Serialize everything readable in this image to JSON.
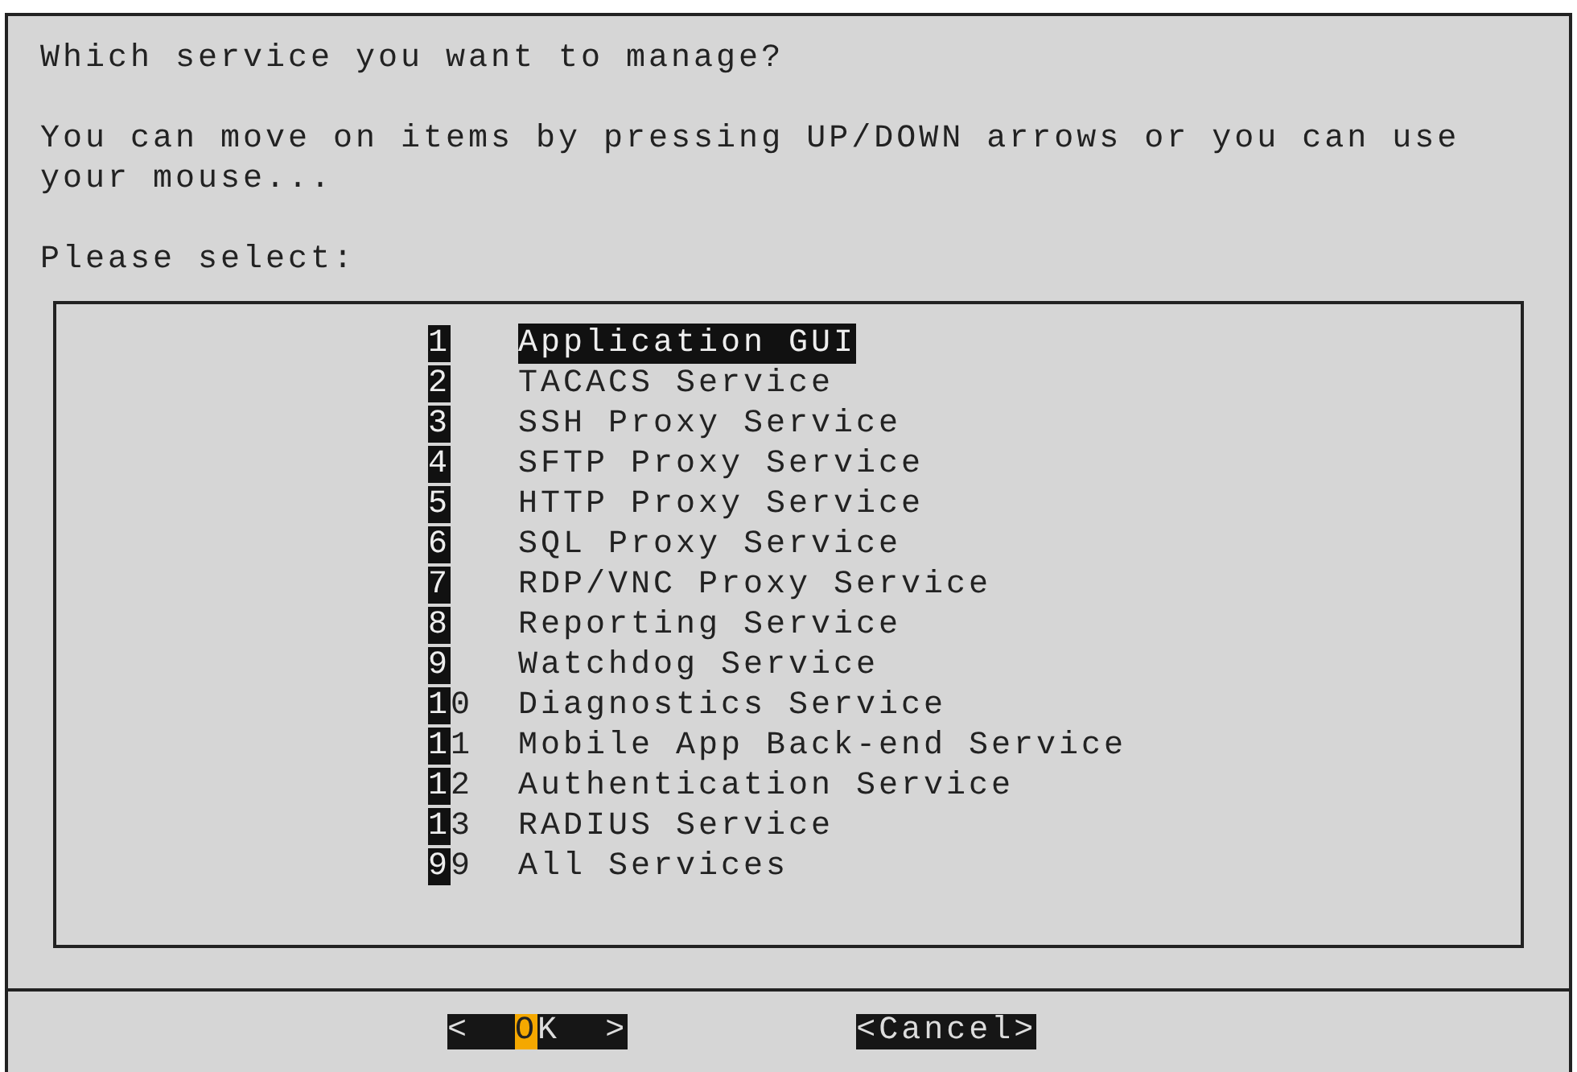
{
  "dialog": {
    "question": "Which service you want to manage?",
    "instructions": [
      "You can move on items by pressing UP/DOWN arrows or you can use",
      "your mouse..."
    ],
    "prompt": "Please select:",
    "items": [
      {
        "tag": "1",
        "label": "Application GUI",
        "selected": true
      },
      {
        "tag": "2",
        "label": "TACACS Service",
        "selected": false
      },
      {
        "tag": "3",
        "label": "SSH Proxy Service",
        "selected": false
      },
      {
        "tag": "4",
        "label": "SFTP Proxy Service",
        "selected": false
      },
      {
        "tag": "5",
        "label": "HTTP Proxy Service",
        "selected": false
      },
      {
        "tag": "6",
        "label": "SQL Proxy Service",
        "selected": false
      },
      {
        "tag": "7",
        "label": "RDP/VNC Proxy Service",
        "selected": false
      },
      {
        "tag": "8",
        "label": "Reporting Service",
        "selected": false
      },
      {
        "tag": "9",
        "label": "Watchdog Service",
        "selected": false
      },
      {
        "tag": "10",
        "label": "Diagnostics Service",
        "selected": false
      },
      {
        "tag": "11",
        "label": "Mobile App Back-end Service",
        "selected": false
      },
      {
        "tag": "12",
        "label": "Authentication Service",
        "selected": false
      },
      {
        "tag": "13",
        "label": "RADIUS Service",
        "selected": false
      },
      {
        "tag": "99",
        "label": "All Services",
        "selected": false
      }
    ],
    "buttons": [
      {
        "open": "<",
        "label": "OK",
        "close": ">",
        "selected": true
      },
      {
        "open": "<",
        "label": "Cancel",
        "close": ">",
        "selected": false
      }
    ]
  }
}
